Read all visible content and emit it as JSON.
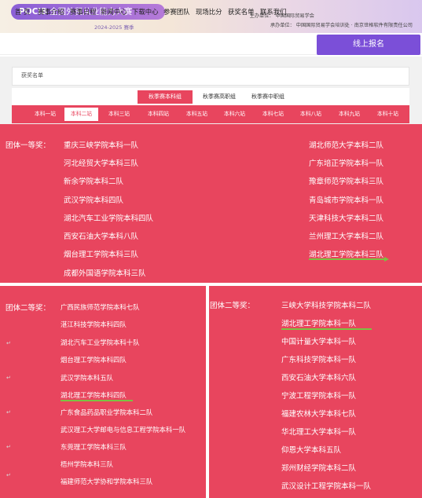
{
  "header": {
    "logo_abbr": "POCIB",
    "logo_title": "全国外贸从业能力大赛",
    "season": "2024-2025 赛季",
    "organizer": "主办单位：  中国国际贸易学会",
    "undertaker": "承办单位：  中国国际贸易学会培训处 · 南京世格软件有限责任公司"
  },
  "nav": {
    "items": [
      "首 页",
      "赛事介绍",
      "赛事日程",
      "新闻中心",
      "下载中心",
      "参赛团队",
      "现场比分",
      "获奖名单",
      "联系我们"
    ],
    "signup": "线上报名"
  },
  "breadcrumb": "获奖名单",
  "season_tabs": [
    "秋季赛本科组",
    "秋季赛高职组",
    "秋季赛中职组"
  ],
  "stations": [
    "本科一站",
    "本科二站",
    "本科三站",
    "本科四站",
    "本科五站",
    "本科六站",
    "本科七站",
    "本科八站",
    "本科九站",
    "本科十站"
  ],
  "first_prize": {
    "label": "团体一等奖：",
    "left": [
      "重庆三峡学院本科一队",
      "河北经贸大学本科三队",
      "新余学院本科二队",
      "武汉学院本科四队",
      "湖北汽车工业学院本科四队",
      "西安石油大学本科八队",
      "烟台理工学院本科三队",
      "成都外国语学院本科三队"
    ],
    "right": [
      "湖北师范大学本科二队",
      "广东培正学院本科一队",
      "豫章师范学院本科三队",
      "青岛城市学院本科一队",
      "天津科技大学本科二队",
      "兰州理工大学本科二队",
      "湖北理工学院本科三队"
    ]
  },
  "second_prize_left": {
    "label": "团体二等奖：",
    "teams": [
      "广西民族师范学院本科七队",
      "湛江科技学院本科四队",
      "湖北汽车工业学院本科十队",
      "烟台理工学院本科四队",
      "武汉学院本科五队",
      "湖北理工学院本科四队",
      "广东食品药品职业学院本科二队",
      "武汉理工大学邮电与信息工程学院本科一队",
      "东莞理工学院本科三队",
      "梧州学院本科三队",
      "福建师范大学协和学院本科三队"
    ]
  },
  "second_prize_right": {
    "label": "团体二等奖：",
    "teams": [
      "三峡大学科技学院本科二队",
      "湖北理工学院本科一队",
      "中国计量大学本科一队",
      "广东科技学院本科一队",
      "西安石油大学本科六队",
      "宁波工程学院本科一队",
      "福建农林大学本科七队",
      "华北理工大学本科一队",
      "仰恩大学本科五队",
      "郑州财经学院本科二队",
      "武汉设计工程学院本科一队"
    ]
  }
}
